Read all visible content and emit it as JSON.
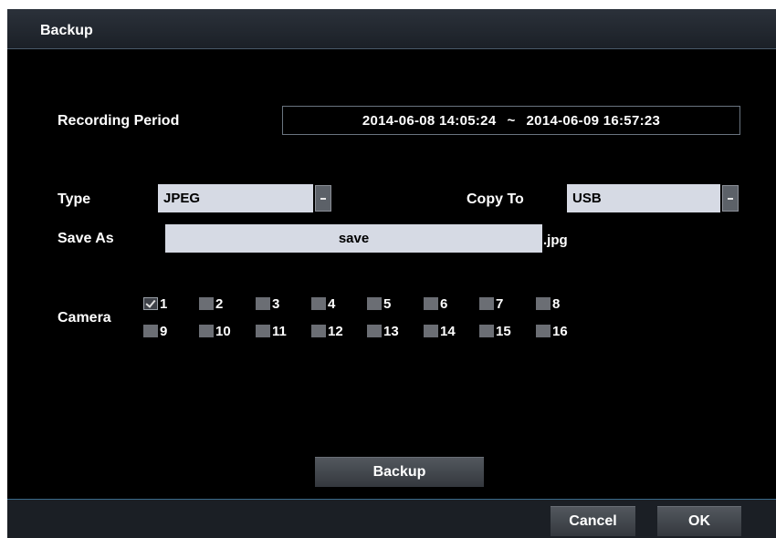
{
  "dialog": {
    "title": "Backup"
  },
  "recording_period": {
    "label": "Recording Period",
    "start": "2014-06-08  14:05:24",
    "separator": "~",
    "end": "2014-06-09  16:57:23"
  },
  "type": {
    "label": "Type",
    "value": "JPEG"
  },
  "copy_to": {
    "label": "Copy To",
    "value": "USB"
  },
  "save_as": {
    "label": "Save As",
    "value": "save",
    "extension": ".jpg"
  },
  "camera": {
    "label": "Camera",
    "channels": [
      {
        "num": "1",
        "checked": true
      },
      {
        "num": "2",
        "checked": false
      },
      {
        "num": "3",
        "checked": false
      },
      {
        "num": "4",
        "checked": false
      },
      {
        "num": "5",
        "checked": false
      },
      {
        "num": "6",
        "checked": false
      },
      {
        "num": "7",
        "checked": false
      },
      {
        "num": "8",
        "checked": false
      },
      {
        "num": "9",
        "checked": false
      },
      {
        "num": "10",
        "checked": false
      },
      {
        "num": "11",
        "checked": false
      },
      {
        "num": "12",
        "checked": false
      },
      {
        "num": "13",
        "checked": false
      },
      {
        "num": "14",
        "checked": false
      },
      {
        "num": "15",
        "checked": false
      },
      {
        "num": "16",
        "checked": false
      }
    ]
  },
  "buttons": {
    "backup": "Backup",
    "cancel": "Cancel",
    "ok": "OK"
  },
  "colors": {
    "background": "#000000",
    "field": "#d6dae4",
    "accent_line": "#3a6a8a"
  },
  "icons": {
    "dropdown": "chevron-down-icon",
    "checkbox_checked": "check-icon"
  }
}
